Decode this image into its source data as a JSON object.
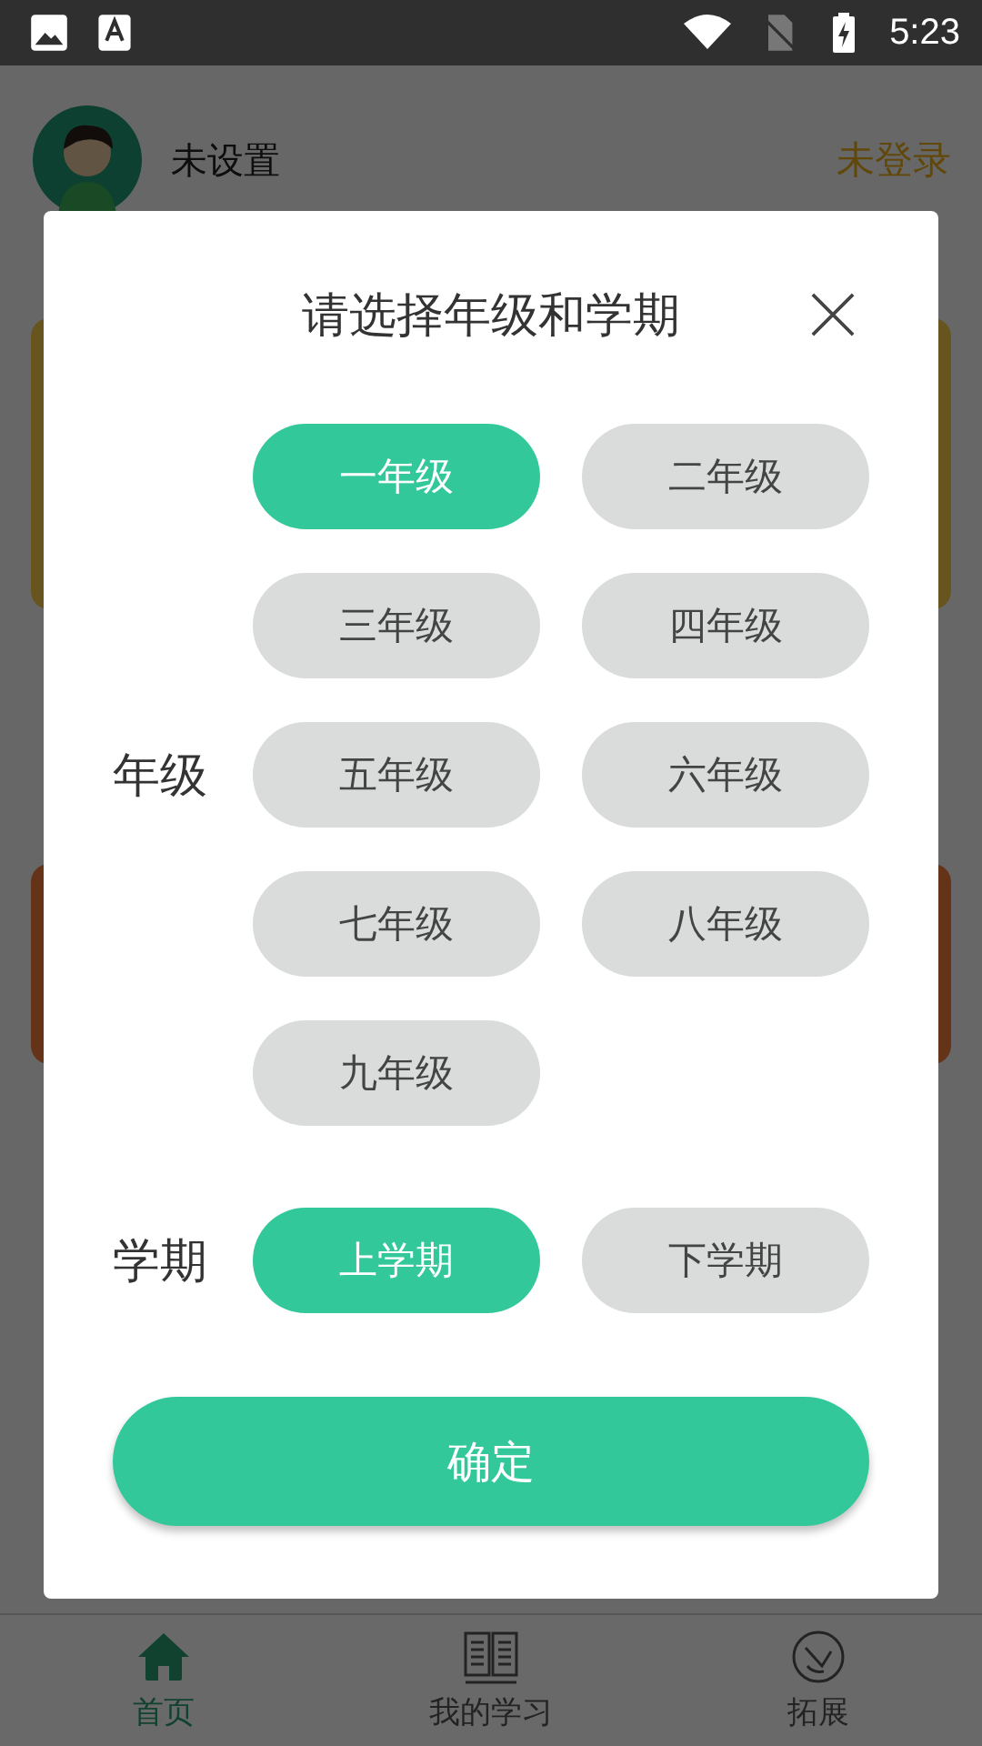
{
  "status_bar": {
    "time": "5:23"
  },
  "header": {
    "name": "未设置",
    "login": "未登录"
  },
  "dialog": {
    "title": "请选择年级和学期",
    "grade_label": "年级",
    "grades": [
      {
        "label": "一年级",
        "selected": true
      },
      {
        "label": "二年级",
        "selected": false
      },
      {
        "label": "三年级",
        "selected": false
      },
      {
        "label": "四年级",
        "selected": false
      },
      {
        "label": "五年级",
        "selected": false
      },
      {
        "label": "六年级",
        "selected": false
      },
      {
        "label": "七年级",
        "selected": false
      },
      {
        "label": "八年级",
        "selected": false
      },
      {
        "label": "九年级",
        "selected": false
      }
    ],
    "term_label": "学期",
    "terms": [
      {
        "label": "上学期",
        "selected": true
      },
      {
        "label": "下学期",
        "selected": false
      }
    ],
    "confirm": "确定"
  },
  "bottom_nav": [
    {
      "label": "首页",
      "selected": true
    },
    {
      "label": "我的学习",
      "selected": false
    },
    {
      "label": "拓展",
      "selected": false
    }
  ]
}
